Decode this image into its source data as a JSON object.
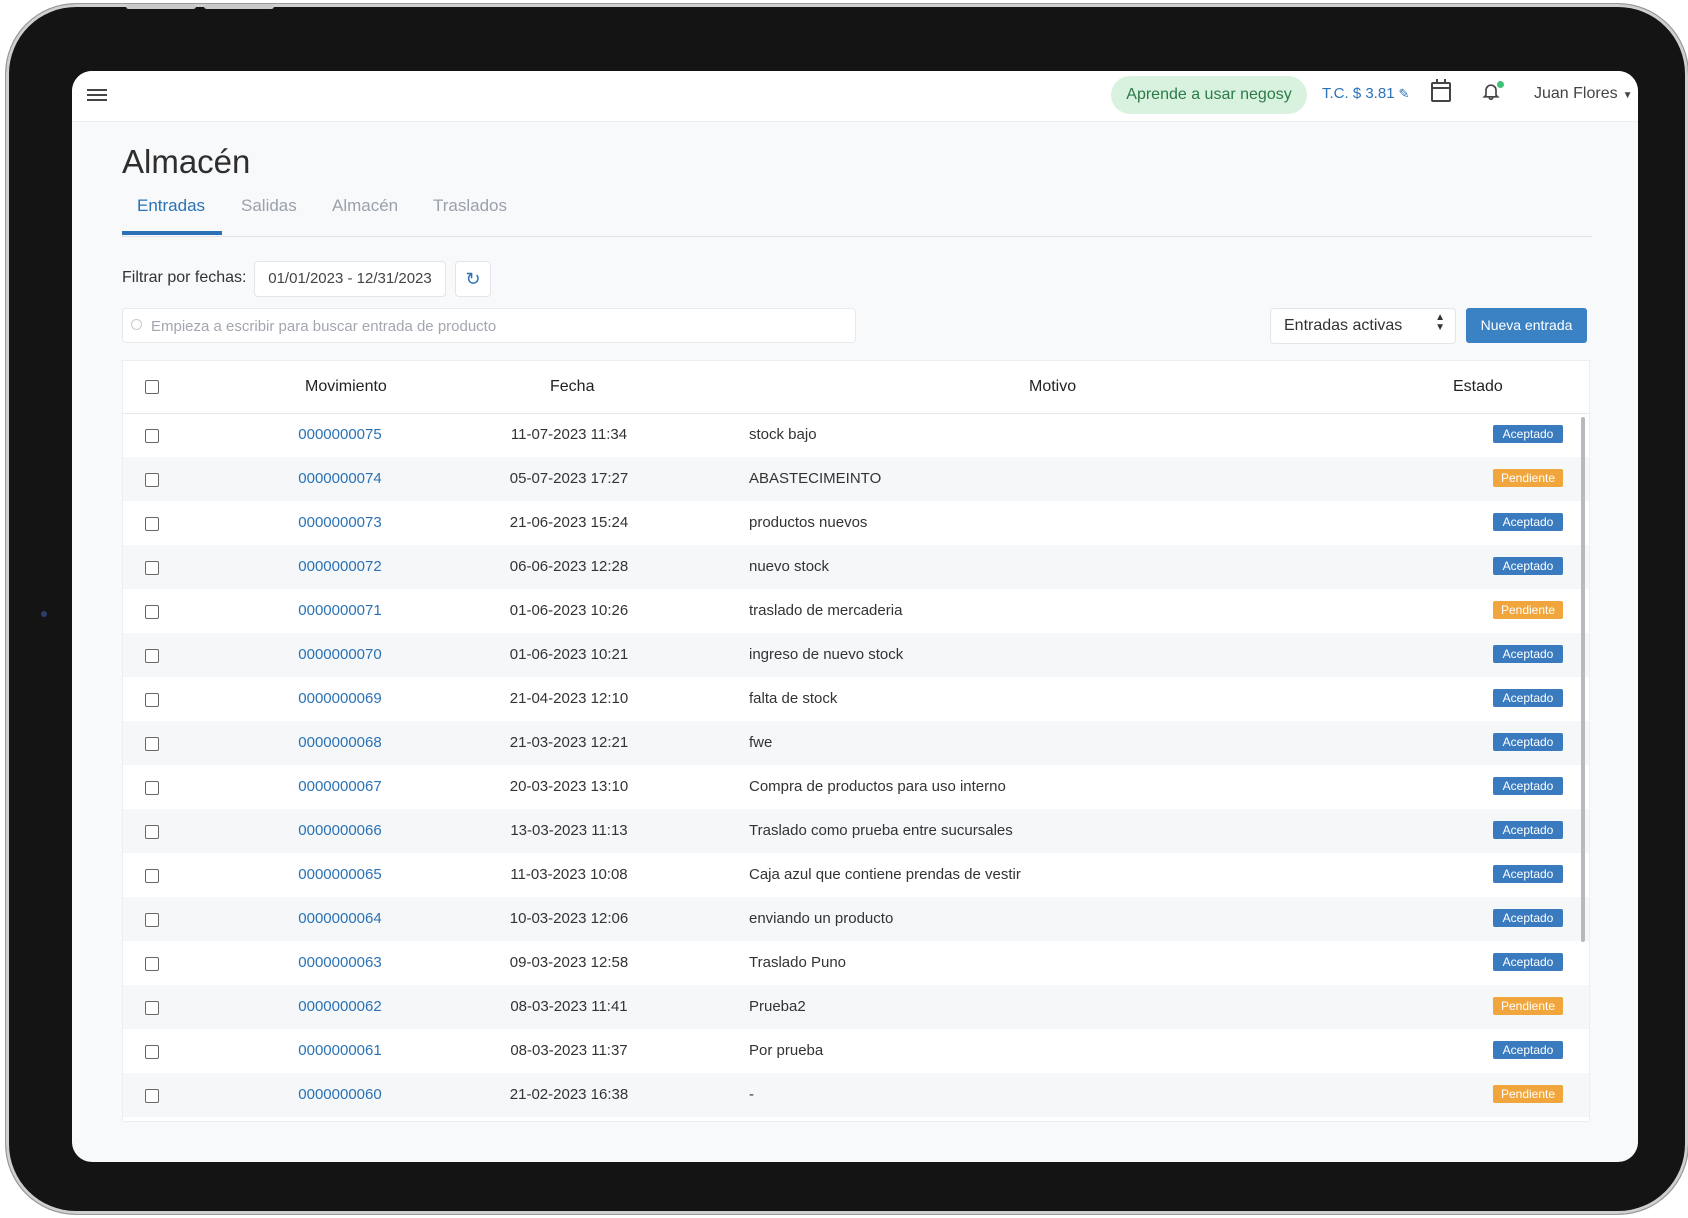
{
  "colors": {
    "accent": "#2a72b5",
    "button": "#3a82c4",
    "accepted": "#3a7bc0",
    "pending": "#f0a63c",
    "learn_bg": "#d8f2df",
    "learn_text": "#2c7a47"
  },
  "topbar": {
    "menu_icon": "hamburger-icon",
    "learn_label": "Aprende a usar negosy",
    "tc_label": "T.C. $ 3.81",
    "tc_icon": "pencil-icon",
    "calendar_icon": "calendar-icon",
    "bell_icon": "bell-icon",
    "user_name": "Juan Flores"
  },
  "page": {
    "title": "Almacén",
    "tabs": [
      {
        "label": "Entradas",
        "active": true
      },
      {
        "label": "Salidas",
        "active": false
      },
      {
        "label": "Almacén",
        "active": false
      },
      {
        "label": "Traslados",
        "active": false
      }
    ]
  },
  "filters": {
    "date_label": "Filtrar por fechas:",
    "date_range": "01/01/2023 - 12/31/2023",
    "search_placeholder": "Empieza a escribir para buscar entrada de producto",
    "select_value": "Entradas activas",
    "new_button": "Nueva entrada"
  },
  "table": {
    "headers": {
      "movimiento": "Movimiento",
      "fecha": "Fecha",
      "motivo": "Motivo",
      "estado": "Estado"
    },
    "rows": [
      {
        "mov": "0000000075",
        "fecha": "11-07-2023 11:34",
        "motivo": "stock bajo",
        "estado": "Aceptado"
      },
      {
        "mov": "0000000074",
        "fecha": "05-07-2023 17:27",
        "motivo": "ABASTECIMEINTO",
        "estado": "Pendiente"
      },
      {
        "mov": "0000000073",
        "fecha": "21-06-2023 15:24",
        "motivo": "productos nuevos",
        "estado": "Aceptado"
      },
      {
        "mov": "0000000072",
        "fecha": "06-06-2023 12:28",
        "motivo": "nuevo stock",
        "estado": "Aceptado"
      },
      {
        "mov": "0000000071",
        "fecha": "01-06-2023 10:26",
        "motivo": "traslado de mercaderia",
        "estado": "Pendiente"
      },
      {
        "mov": "0000000070",
        "fecha": "01-06-2023 10:21",
        "motivo": "ingreso de nuevo stock",
        "estado": "Aceptado"
      },
      {
        "mov": "0000000069",
        "fecha": "21-04-2023 12:10",
        "motivo": "falta de stock",
        "estado": "Aceptado"
      },
      {
        "mov": "0000000068",
        "fecha": "21-03-2023 12:21",
        "motivo": "fwe",
        "estado": "Aceptado"
      },
      {
        "mov": "0000000067",
        "fecha": "20-03-2023 13:10",
        "motivo": "Compra de productos para uso interno",
        "estado": "Aceptado"
      },
      {
        "mov": "0000000066",
        "fecha": "13-03-2023 11:13",
        "motivo": "Traslado como prueba entre sucursales",
        "estado": "Aceptado"
      },
      {
        "mov": "0000000065",
        "fecha": "11-03-2023 10:08",
        "motivo": "Caja azul que contiene prendas de vestir",
        "estado": "Aceptado"
      },
      {
        "mov": "0000000064",
        "fecha": "10-03-2023 12:06",
        "motivo": "enviando un producto",
        "estado": "Aceptado"
      },
      {
        "mov": "0000000063",
        "fecha": "09-03-2023 12:58",
        "motivo": "Traslado Puno",
        "estado": "Aceptado"
      },
      {
        "mov": "0000000062",
        "fecha": "08-03-2023 11:41",
        "motivo": "Prueba2",
        "estado": "Pendiente"
      },
      {
        "mov": "0000000061",
        "fecha": "08-03-2023 11:37",
        "motivo": "Por prueba",
        "estado": "Aceptado"
      },
      {
        "mov": "0000000060",
        "fecha": "21-02-2023 16:38",
        "motivo": "-",
        "estado": "Pendiente"
      }
    ]
  }
}
